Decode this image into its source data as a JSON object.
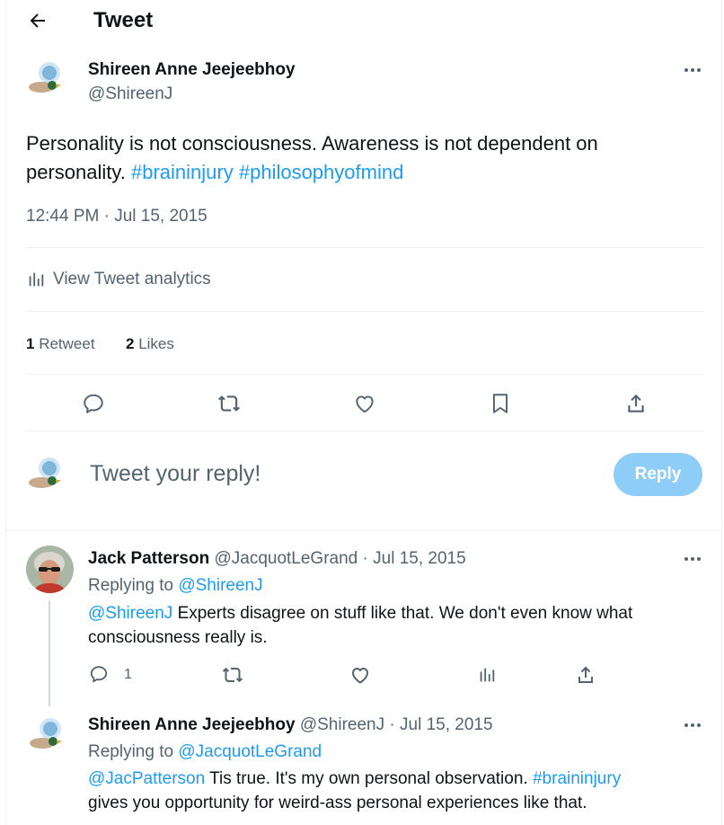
{
  "header": {
    "title": "Tweet"
  },
  "tweet": {
    "author_name": "Shireen Anne Jeejeebhoy",
    "author_handle": "@ShireenJ",
    "text_plain": "Personality is not consciousness. Awareness is not dependent on personality.",
    "hashtag_1": "#braininjury",
    "hashtag_2": "#philosophyofmind",
    "timestamp": "12:44 PM · Jul 15, 2015",
    "analytics_label": "View Tweet analytics",
    "retweet_count": "1",
    "retweet_label": "Retweet",
    "like_count": "2",
    "like_label": "Likes"
  },
  "reply_box": {
    "placeholder": "Tweet your reply!",
    "button_label": "Reply"
  },
  "replies": [
    {
      "author_name": "Jack Patterson",
      "author_handle": "@JacquotLeGrand",
      "date": "· Jul 15, 2015",
      "replying_to_label": "Replying to",
      "replying_to_handle": "@ShireenJ",
      "mention": "@ShireenJ",
      "text_line1": "Experts disagree on stuff like that. We don't even know what",
      "text_line2": "consciousness really is.",
      "reply_count": "1"
    },
    {
      "author_name": "Shireen Anne Jeejeebhoy",
      "author_handle": "@ShireenJ",
      "date": "· Jul 15, 2015",
      "replying_to_label": "Replying to",
      "replying_to_handle": "@JacquotLeGrand",
      "mention": "@JacPatterson",
      "text_mid": "Tis true. It's my own personal observation.",
      "hashtag": "#braininjury",
      "text_line2": "gives you opportunity for weird-ass personal experiences like that."
    }
  ],
  "colors": {
    "accent": "#1d9bf0",
    "reply_button_bg": "#8ecdf8",
    "secondary_text": "#536471",
    "divider": "#eff3f4"
  }
}
